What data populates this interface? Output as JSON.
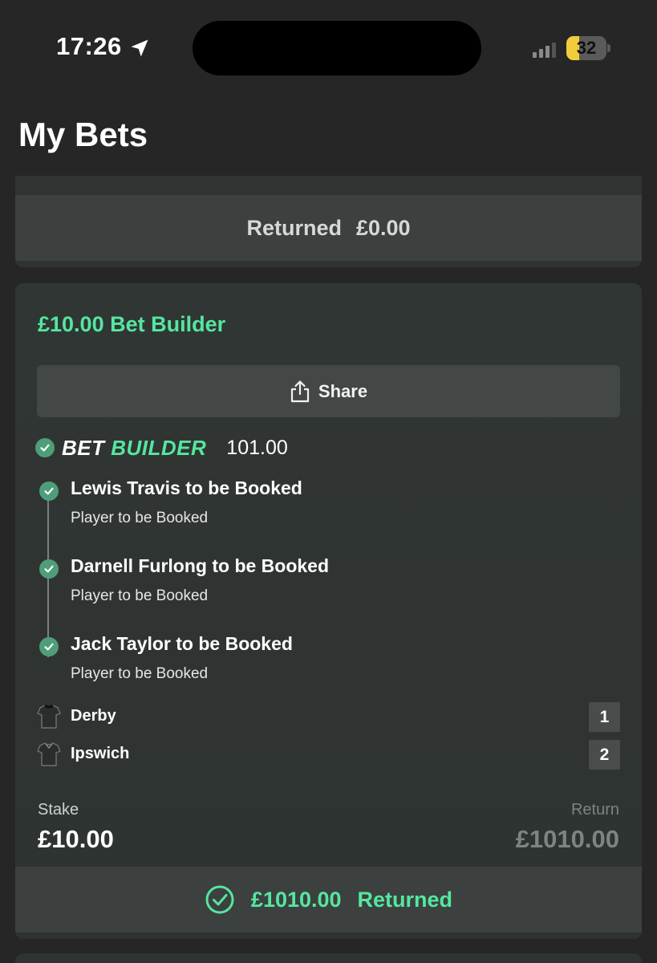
{
  "status_bar": {
    "time": "17:26",
    "battery": "32",
    "battery_fraction": 0.32,
    "accent": "#f0cd3b"
  },
  "page": {
    "title": "My Bets"
  },
  "previous_card": {
    "returned_label": "Returned",
    "returned_amount": "£0.00"
  },
  "bet": {
    "title": "£10.00 Bet Builder",
    "share_label": "Share",
    "builder_word1": "BET",
    "builder_word2": "BUILDER",
    "odds": "101.00",
    "legs": [
      {
        "title": "Lewis Travis to be Booked",
        "market": "Player to be Booked",
        "status": "won"
      },
      {
        "title": "Darnell Furlong to be Booked",
        "market": "Player to be Booked",
        "status": "won"
      },
      {
        "title": "Jack Taylor to be Booked",
        "market": "Player to be Booked",
        "status": "won"
      }
    ],
    "teams": [
      {
        "name": "Derby",
        "score": "1"
      },
      {
        "name": "Ipswich",
        "score": "2"
      }
    ],
    "stake_label": "Stake",
    "stake": "£10.00",
    "return_label": "Return",
    "return": "£1010.00",
    "result_amount": "£1010.00",
    "result_label": "Returned"
  },
  "colors": {
    "accent_green": "#55e6a0",
    "check_green": "#4f9e79",
    "background": "#262626"
  },
  "icons": [
    "location-arrow-icon",
    "signal-icon",
    "battery-icon",
    "share-icon",
    "check-circle-icon",
    "shirt-icon"
  ]
}
